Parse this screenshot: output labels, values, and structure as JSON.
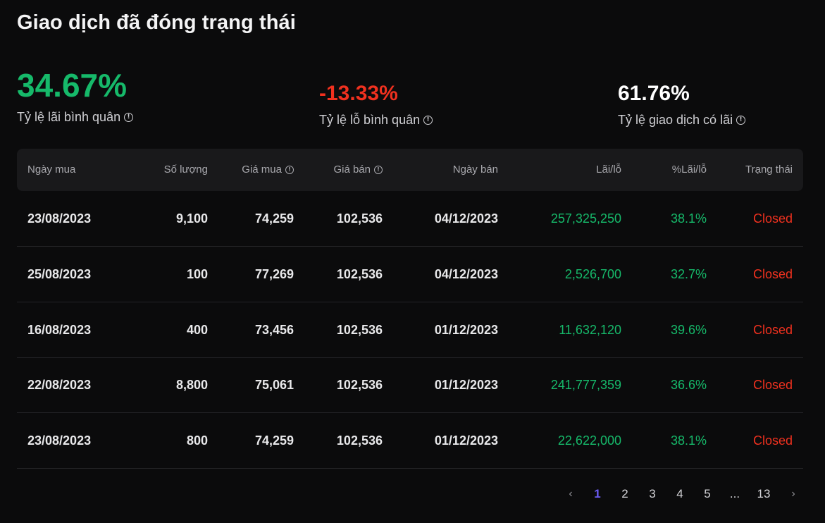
{
  "title": "Giao dịch đã đóng trạng thái",
  "stats": [
    {
      "value": "34.67%",
      "label": "Tỷ lệ lãi bình quân",
      "color": "#16b96a"
    },
    {
      "value": "-13.33%",
      "label": "Tỷ lệ lỗ bình quân",
      "color": "#f0311f"
    },
    {
      "value": "61.76%",
      "label": "Tỷ lệ giao dịch có lãi",
      "color": "#ffffff"
    }
  ],
  "columns": {
    "buy_date": "Ngày mua",
    "qty": "Số lượng",
    "buy_price": "Giá mua",
    "sell_price": "Giá bán",
    "sell_date": "Ngày bán",
    "pl": "Lãi/lỗ",
    "pct": "%Lãi/lỗ",
    "status": "Trạng thái"
  },
  "rows": [
    {
      "buy_date": "23/08/2023",
      "qty": "9,100",
      "buy_price": "74,259",
      "sell_price": "102,536",
      "sell_date": "04/12/2023",
      "pl": "257,325,250",
      "pct": "38.1%",
      "status": "Closed"
    },
    {
      "buy_date": "25/08/2023",
      "qty": "100",
      "buy_price": "77,269",
      "sell_price": "102,536",
      "sell_date": "04/12/2023",
      "pl": "2,526,700",
      "pct": "32.7%",
      "status": "Closed"
    },
    {
      "buy_date": "16/08/2023",
      "qty": "400",
      "buy_price": "73,456",
      "sell_price": "102,536",
      "sell_date": "01/12/2023",
      "pl": "11,632,120",
      "pct": "39.6%",
      "status": "Closed"
    },
    {
      "buy_date": "22/08/2023",
      "qty": "8,800",
      "buy_price": "75,061",
      "sell_price": "102,536",
      "sell_date": "01/12/2023",
      "pl": "241,777,359",
      "pct": "36.6%",
      "status": "Closed"
    },
    {
      "buy_date": "23/08/2023",
      "qty": "800",
      "buy_price": "74,259",
      "sell_price": "102,536",
      "sell_date": "01/12/2023",
      "pl": "22,622,000",
      "pct": "38.1%",
      "status": "Closed"
    }
  ],
  "pagination": {
    "prev": "‹",
    "pages": [
      "1",
      "2",
      "3",
      "4",
      "5",
      "...",
      "13"
    ],
    "active": "1",
    "next": "›"
  },
  "icons": {
    "info": "info-circle-icon",
    "prev": "chevron-left-icon",
    "next": "chevron-right-icon"
  },
  "colors": {
    "profit": "#16b96a",
    "loss": "#f0311f",
    "accent": "#6c5cf5",
    "background": "#0b0b0c"
  }
}
